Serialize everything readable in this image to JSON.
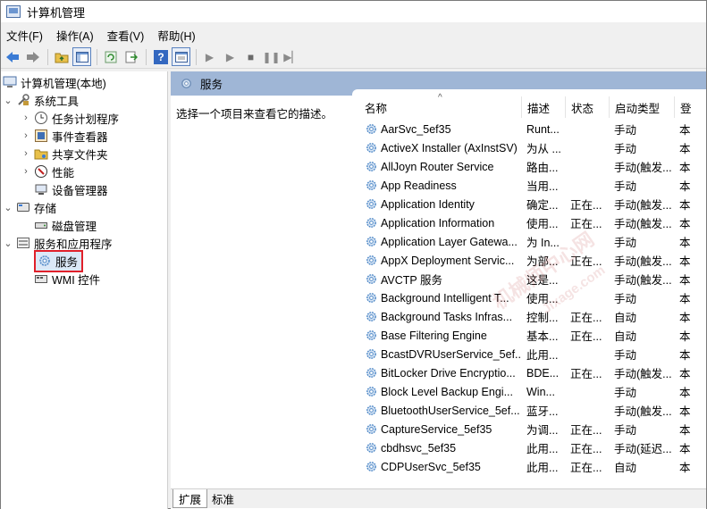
{
  "window": {
    "title": "计算机管理"
  },
  "menu": [
    "文件(F)",
    "操作(A)",
    "查看(V)",
    "帮助(H)"
  ],
  "tree": {
    "root": "计算机管理(本地)",
    "items": [
      {
        "label": "系统工具",
        "level": 1,
        "expander": "expanded",
        "icon": "tools-icon"
      },
      {
        "label": "任务计划程序",
        "level": 2,
        "expander": "collapsed",
        "icon": "clock-icon"
      },
      {
        "label": "事件查看器",
        "level": 2,
        "expander": "collapsed",
        "icon": "event-viewer-icon"
      },
      {
        "label": "共享文件夹",
        "level": 2,
        "expander": "collapsed",
        "icon": "shared-folder-icon"
      },
      {
        "label": "性能",
        "level": 2,
        "expander": "collapsed",
        "icon": "performance-icon"
      },
      {
        "label": "设备管理器",
        "level": 2,
        "expander": "none",
        "icon": "device-manager-icon"
      },
      {
        "label": "存储",
        "level": 1,
        "expander": "expanded",
        "icon": "storage-icon"
      },
      {
        "label": "磁盘管理",
        "level": 2,
        "expander": "none",
        "icon": "disk-icon"
      },
      {
        "label": "服务和应用程序",
        "level": 1,
        "expander": "expanded",
        "icon": "services-apps-icon"
      },
      {
        "label": "服务",
        "level": 2,
        "expander": "none",
        "icon": "gear-icon",
        "selected": true
      },
      {
        "label": "WMI 控件",
        "level": 2,
        "expander": "none",
        "icon": "wmi-icon"
      }
    ]
  },
  "panel": {
    "header": "服务",
    "description": "选择一个项目来查看它的描述。"
  },
  "columns": [
    "名称",
    "描述",
    "状态",
    "启动类型",
    "登"
  ],
  "services": [
    {
      "name": "AarSvc_5ef35",
      "desc": "Runt...",
      "status": "",
      "startup": "手动",
      "logon": "本"
    },
    {
      "name": "ActiveX Installer (AxInstSV)",
      "desc": "为从 ...",
      "status": "",
      "startup": "手动",
      "logon": "本"
    },
    {
      "name": "AllJoyn Router Service",
      "desc": "路由...",
      "status": "",
      "startup": "手动(触发...",
      "logon": "本"
    },
    {
      "name": "App Readiness",
      "desc": "当用...",
      "status": "",
      "startup": "手动",
      "logon": "本"
    },
    {
      "name": "Application Identity",
      "desc": "确定...",
      "status": "正在...",
      "startup": "手动(触发...",
      "logon": "本"
    },
    {
      "name": "Application Information",
      "desc": "使用...",
      "status": "正在...",
      "startup": "手动(触发...",
      "logon": "本"
    },
    {
      "name": "Application Layer Gatewa...",
      "desc": "为 In...",
      "status": "",
      "startup": "手动",
      "logon": "本"
    },
    {
      "name": "AppX Deployment Servic...",
      "desc": "为部...",
      "status": "正在...",
      "startup": "手动(触发...",
      "logon": "本"
    },
    {
      "name": "AVCTP 服务",
      "desc": "这是...",
      "status": "",
      "startup": "手动(触发...",
      "logon": "本"
    },
    {
      "name": "Background Intelligent T...",
      "desc": "使用...",
      "status": "",
      "startup": "手动",
      "logon": "本"
    },
    {
      "name": "Background Tasks Infras...",
      "desc": "控制...",
      "status": "正在...",
      "startup": "自动",
      "logon": "本"
    },
    {
      "name": "Base Filtering Engine",
      "desc": "基本...",
      "status": "正在...",
      "startup": "自动",
      "logon": "本"
    },
    {
      "name": "BcastDVRUserService_5ef...",
      "desc": "此用...",
      "status": "",
      "startup": "手动",
      "logon": "本"
    },
    {
      "name": "BitLocker Drive Encryptio...",
      "desc": "BDE...",
      "status": "正在...",
      "startup": "手动(触发...",
      "logon": "本"
    },
    {
      "name": "Block Level Backup Engi...",
      "desc": "Win...",
      "status": "",
      "startup": "手动",
      "logon": "本"
    },
    {
      "name": "BluetoothUserService_5ef...",
      "desc": "蓝牙...",
      "status": "",
      "startup": "手动(触发...",
      "logon": "本"
    },
    {
      "name": "CaptureService_5ef35",
      "desc": "为调...",
      "status": "正在...",
      "startup": "手动",
      "logon": "本"
    },
    {
      "name": "cbdhsvc_5ef35",
      "desc": "此用...",
      "status": "正在...",
      "startup": "手动(延迟...",
      "logon": "本"
    },
    {
      "name": "CDPUserSvc_5ef35",
      "desc": "此用...",
      "status": "正在...",
      "startup": "自动",
      "logon": "本"
    }
  ],
  "tabs": [
    "扩展",
    "标准"
  ],
  "watermark": {
    "line1": "机械师中心网",
    "line2": "Jixage.com"
  },
  "colors": {
    "panel_header": "#9fb6d6",
    "selection_outline": "#e0202a",
    "gear_blue": "#4e88c7"
  }
}
